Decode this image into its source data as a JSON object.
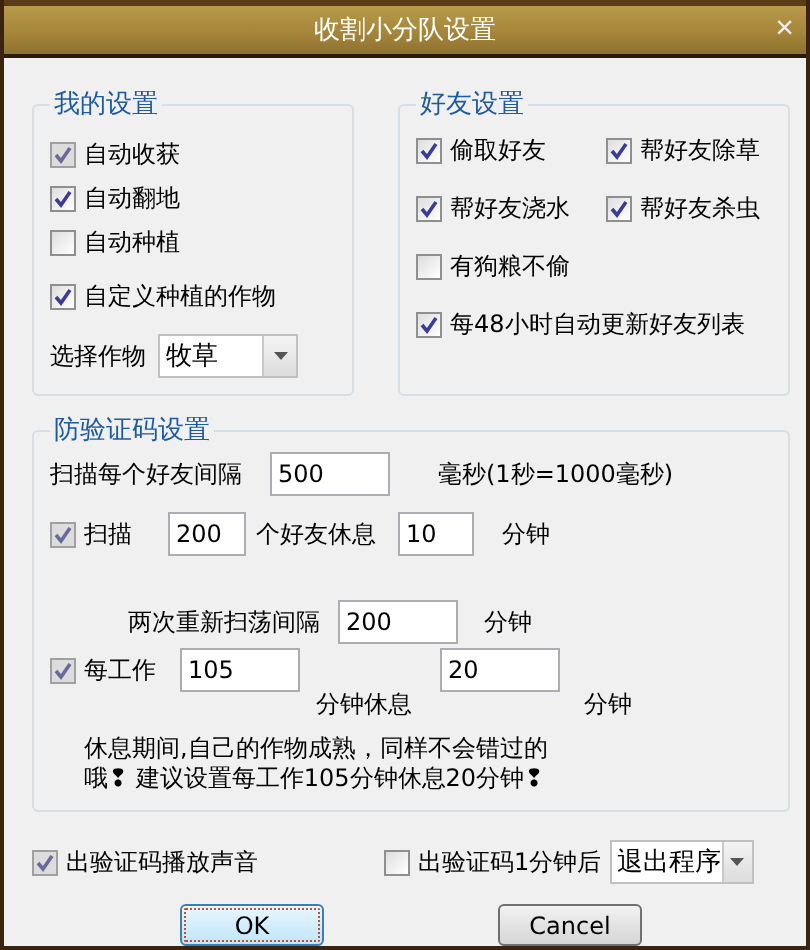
{
  "window": {
    "title": "收割小分队设置",
    "close": "×"
  },
  "my_settings": {
    "title": "我的设置",
    "options": [
      {
        "label": "自动收获",
        "checked": true,
        "disabled": true
      },
      {
        "label": "自动翻地",
        "checked": true,
        "disabled": false
      },
      {
        "label": "自动种植",
        "checked": false,
        "disabled": false
      },
      {
        "label": "自定义种植的作物",
        "checked": true,
        "disabled": false
      }
    ],
    "crop": {
      "label": "选择作物",
      "value": "牧草"
    }
  },
  "friend_settings": {
    "title": "好友设置",
    "options": [
      {
        "label": "偷取好友",
        "checked": true
      },
      {
        "label": "帮好友除草",
        "checked": true
      },
      {
        "label": "帮好友浇水",
        "checked": true
      },
      {
        "label": "帮好友杀虫",
        "checked": true
      },
      {
        "label": "有狗粮不偷",
        "checked": false
      },
      {
        "label": "每48小时自动更新好友列表",
        "checked": true
      }
    ]
  },
  "anti_captcha": {
    "title": "防验证码设置",
    "scan_interval": {
      "label": "扫描每个好友间隔",
      "value": "500",
      "unit": "毫秒(1秒=1000毫秒)"
    },
    "scan_rest": {
      "label": "扫描",
      "checked": true,
      "disabled": true,
      "count": "200",
      "middle": "个好友休息",
      "minutes": "10",
      "unit": "分钟"
    },
    "rescan": {
      "label": "两次重新扫荡间隔",
      "value": "200",
      "unit": "分钟"
    },
    "work": {
      "label": "每工作",
      "checked": true,
      "disabled": true,
      "work_minutes": "105",
      "middle": "分钟休息",
      "rest_minutes": "20",
      "unit": "分钟"
    },
    "note": "休息期间,自己的作物成熟，同样不会错过的哦❢ 建议设置每工作105分钟休息20分钟❢"
  },
  "sound": {
    "label": "出验证码播放声音",
    "checked": true,
    "disabled": true
  },
  "after_captcha": {
    "label": "出验证码1分钟后",
    "checked": false,
    "disabled": false,
    "action": "退出程序"
  },
  "buttons": [
    {
      "label": "OK",
      "default": true
    },
    {
      "label": "Cancel",
      "default": false
    }
  ]
}
